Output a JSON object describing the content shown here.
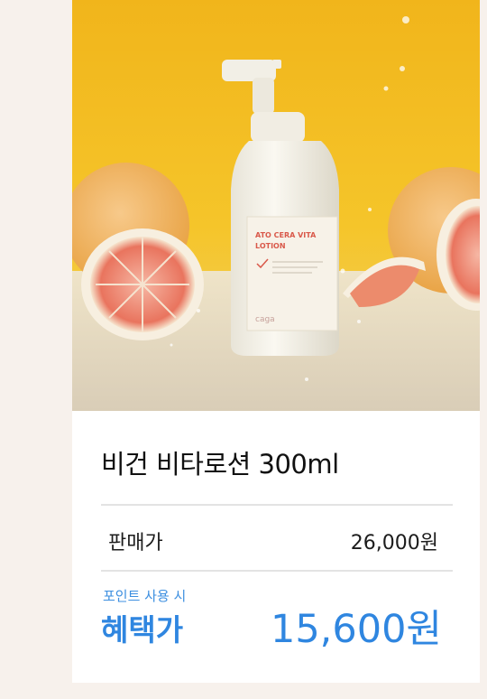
{
  "product": {
    "name": "비건 비타로션 300ml",
    "image_label": {
      "line1": "ATO CERA VITA",
      "line2": "LOTION",
      "brand": "caga"
    }
  },
  "pricing": {
    "sale_label": "판매가",
    "sale_price": "26,000원",
    "point_label": "포인트 사용 시",
    "benefit_label": "혜택가",
    "benefit_price": "15,600원"
  },
  "colors": {
    "page_bg": "#f7f1ec",
    "card_bg": "#ffffff",
    "accent_blue": "#2f86e0",
    "hero_yellow": "#f3c21f",
    "label_red": "#d9594a"
  }
}
